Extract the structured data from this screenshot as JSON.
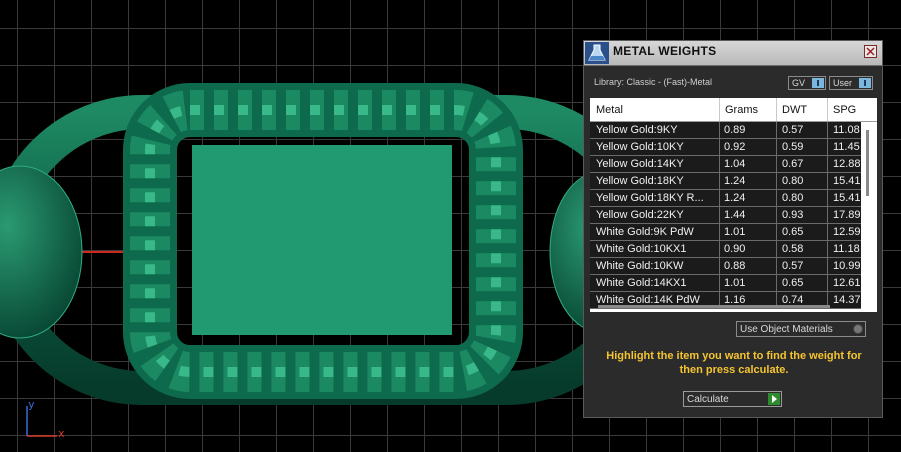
{
  "viewport": {
    "axis_y": "y",
    "axis_x": "x"
  },
  "panel": {
    "title": "METAL WEIGHTS",
    "library_label": "Library: Classic - (Fast)-Metal",
    "gv_label": "GV",
    "user_label": "User",
    "columns": [
      "Metal",
      "Grams",
      "DWT",
      "SPG"
    ],
    "rows": [
      {
        "metal": "Yellow Gold:9KY",
        "grams": "0.89",
        "dwt": "0.57",
        "spg": "11.08"
      },
      {
        "metal": "Yellow Gold:10KY",
        "grams": "0.92",
        "dwt": "0.59",
        "spg": "11.45"
      },
      {
        "metal": "Yellow Gold:14KY",
        "grams": "1.04",
        "dwt": "0.67",
        "spg": "12.88"
      },
      {
        "metal": "Yellow Gold:18KY",
        "grams": "1.24",
        "dwt": "0.80",
        "spg": "15.41"
      },
      {
        "metal": "Yellow Gold:18KY R...",
        "grams": "1.24",
        "dwt": "0.80",
        "spg": "15.41"
      },
      {
        "metal": "Yellow Gold:22KY",
        "grams": "1.44",
        "dwt": "0.93",
        "spg": "17.89"
      },
      {
        "metal": "White Gold:9K PdW",
        "grams": "1.01",
        "dwt": "0.65",
        "spg": "12.59"
      },
      {
        "metal": "White Gold:10KX1",
        "grams": "0.90",
        "dwt": "0.58",
        "spg": "11.18"
      },
      {
        "metal": "White Gold:10KW",
        "grams": "0.88",
        "dwt": "0.57",
        "spg": "10.99"
      },
      {
        "metal": "White Gold:14KX1",
        "grams": "1.01",
        "dwt": "0.65",
        "spg": "12.61"
      },
      {
        "metal": "White Gold:14K PdW",
        "grams": "1.16",
        "dwt": "0.74",
        "spg": "14.37"
      }
    ],
    "use_object_materials": "Use Object Materials",
    "hint": "Highlight the item you want to find the weight for then press calculate.",
    "calculate_label": "Calculate"
  },
  "colors": {
    "model_green": "#0f6e51",
    "hint_yellow": "#f4c531",
    "grid": "#3a3a3a"
  }
}
